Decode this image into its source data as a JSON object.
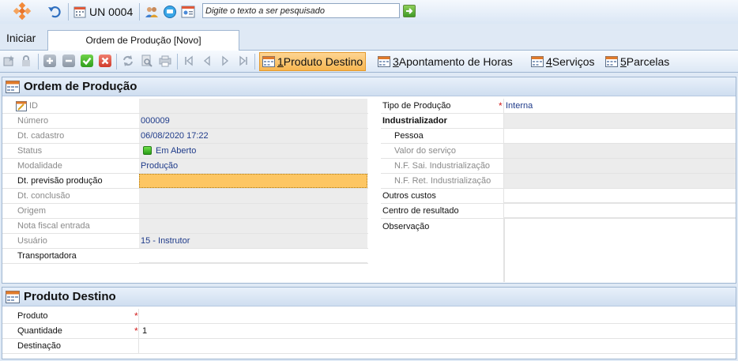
{
  "topbar": {
    "unit": "UN 0004",
    "search_placeholder": "Digite o texto a ser pesquisado"
  },
  "start": {
    "label": "Iniciar"
  },
  "document_tab": {
    "label": "Ordem de Produção [Novo]"
  },
  "toolbar": {
    "tabs": [
      {
        "key": "1",
        "rest": " Produto Destino",
        "active": true
      },
      {
        "key": "3",
        "rest": " Apontamento de Horas",
        "active": false
      },
      {
        "key": "4",
        "rest": " Serviços",
        "active": false
      },
      {
        "key": "5",
        "rest": " Parcelas",
        "active": false
      }
    ]
  },
  "ordem": {
    "title": "Ordem de Produção",
    "left_fields": [
      {
        "label": "ID",
        "value": ""
      },
      {
        "label": "Número",
        "value": "000009"
      },
      {
        "label": "Dt. cadastro",
        "value": "06/08/2020 17:22"
      },
      {
        "label": "Status",
        "value": "Em Aberto"
      },
      {
        "label": "Modalidade",
        "value": "Produção"
      },
      {
        "label": "Dt. previsão produção",
        "value": ""
      },
      {
        "label": "Dt. conclusão",
        "value": ""
      },
      {
        "label": "Origem",
        "value": ""
      },
      {
        "label": "Nota fiscal entrada",
        "value": ""
      },
      {
        "label": "Usuário",
        "value": "15 - Instrutor"
      },
      {
        "label": "Transportadora",
        "value": ""
      }
    ],
    "right_fields": [
      {
        "label": "Tipo de Produção",
        "value": "Interna"
      },
      {
        "label": "Industrializador",
        "value": ""
      },
      {
        "label": "Pessoa",
        "value": ""
      },
      {
        "label": "Valor do serviço",
        "value": ""
      },
      {
        "label": "N.F. Sai. Industrialização",
        "value": ""
      },
      {
        "label": "N.F. Ret. Industrialização",
        "value": ""
      },
      {
        "label": "Outros custos",
        "value": ""
      },
      {
        "label": "Centro de resultado",
        "value": ""
      },
      {
        "label": "Observação",
        "value": ""
      }
    ]
  },
  "produto": {
    "title": "Produto Destino",
    "fields": [
      {
        "label": "Produto",
        "value": ""
      },
      {
        "label": "Quantidade",
        "value": "1"
      },
      {
        "label": "Destinação",
        "value": ""
      }
    ]
  }
}
